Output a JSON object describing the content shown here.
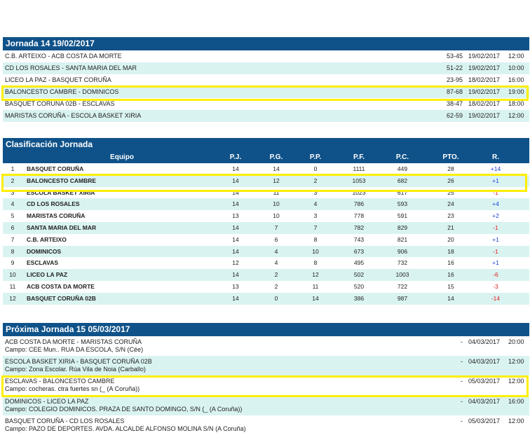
{
  "jornada": {
    "title": "Jornada 14 19/02/2017",
    "matches": [
      {
        "teams": "C.B. ARTEIXO - ACB COSTA DA MORTE",
        "score": "53-45",
        "date": "19/02/2017",
        "time": "12:00"
      },
      {
        "teams": "CD LOS ROSALES - SANTA MARIA DEL MAR",
        "score": "51-22",
        "date": "19/02/2017",
        "time": "10:00"
      },
      {
        "teams": "LICEO LA PAZ - BASQUET CORUÑA",
        "score": "23-95",
        "date": "18/02/2017",
        "time": "16:00"
      },
      {
        "teams": "BALONCESTO CAMBRE - DOMINICOS",
        "score": "87-68",
        "date": "19/02/2017",
        "time": "19:00"
      },
      {
        "teams": "BASQUET CORUÑA 02B - ESCLAVAS",
        "score": "38-47",
        "date": "18/02/2017",
        "time": "18:00"
      },
      {
        "teams": "MARISTAS CORUÑA - ESCOLA BASKET XIRIA",
        "score": "62-59",
        "date": "19/02/2017",
        "time": "12:00"
      }
    ]
  },
  "clasificacion": {
    "title": "Clasificación Jornada",
    "headers": {
      "equipo": "Equipo",
      "pj": "P.J.",
      "pg": "P.G.",
      "pp": "P.P.",
      "pf": "P.F.",
      "pc": "P.C.",
      "pto": "PTO.",
      "r": "R."
    },
    "rows": [
      {
        "pos": "1",
        "team": "BASQUET CORUÑA",
        "pj": "14",
        "pg": "14",
        "pp": "0",
        "pf": "1111",
        "pc": "449",
        "pto": "28",
        "r": "+14"
      },
      {
        "pos": "2",
        "team": "BALONCESTO CAMBRE",
        "pj": "14",
        "pg": "12",
        "pp": "2",
        "pf": "1053",
        "pc": "682",
        "pto": "26",
        "r": "+1"
      },
      {
        "pos": "3",
        "team": "ESCOLA BASKET XIRIA",
        "pj": "14",
        "pg": "11",
        "pp": "3",
        "pf": "1023",
        "pc": "617",
        "pto": "25",
        "r": "-1"
      },
      {
        "pos": "4",
        "team": "CD LOS ROSALES",
        "pj": "14",
        "pg": "10",
        "pp": "4",
        "pf": "786",
        "pc": "593",
        "pto": "24",
        "r": "+4"
      },
      {
        "pos": "5",
        "team": "MARISTAS CORUÑA",
        "pj": "13",
        "pg": "10",
        "pp": "3",
        "pf": "778",
        "pc": "591",
        "pto": "23",
        "r": "+2"
      },
      {
        "pos": "6",
        "team": "SANTA MARIA DEL MAR",
        "pj": "14",
        "pg": "7",
        "pp": "7",
        "pf": "782",
        "pc": "829",
        "pto": "21",
        "r": "-1"
      },
      {
        "pos": "7",
        "team": "C.B. ARTEIXO",
        "pj": "14",
        "pg": "6",
        "pp": "8",
        "pf": "743",
        "pc": "821",
        "pto": "20",
        "r": "+1"
      },
      {
        "pos": "8",
        "team": "DOMINICOS",
        "pj": "14",
        "pg": "4",
        "pp": "10",
        "pf": "673",
        "pc": "906",
        "pto": "18",
        "r": "-1"
      },
      {
        "pos": "9",
        "team": "ESCLAVAS",
        "pj": "12",
        "pg": "4",
        "pp": "8",
        "pf": "495",
        "pc": "732",
        "pto": "16",
        "r": "+1"
      },
      {
        "pos": "10",
        "team": "LICEO LA PAZ",
        "pj": "14",
        "pg": "2",
        "pp": "12",
        "pf": "502",
        "pc": "1003",
        "pto": "16",
        "r": "-6"
      },
      {
        "pos": "11",
        "team": "ACB COSTA DA MORTE",
        "pj": "13",
        "pg": "2",
        "pp": "11",
        "pf": "520",
        "pc": "722",
        "pto": "15",
        "r": "-3"
      },
      {
        "pos": "12",
        "team": "BASQUET CORUÑA 02B",
        "pj": "14",
        "pg": "0",
        "pp": "14",
        "pf": "386",
        "pc": "987",
        "pto": "14",
        "r": "-14"
      }
    ]
  },
  "proxima": {
    "title": "Próxima Jornada 15 05/03/2017",
    "matches": [
      {
        "teams": "ACB COSTA DA MORTE - MARISTAS CORUÑA",
        "campo": "Campo: CEE Mun.. RUA DA ESCOLA, S/N (Cée)",
        "dash": "-",
        "date": "04/03/2017",
        "time": "20:00"
      },
      {
        "teams": "ESCOLA BASKET XIRIA - BASQUET CORUÑA 02B",
        "campo": "Campo: Zona Escolar. Rúa Vila de Noia (Carballo)",
        "dash": "-",
        "date": "04/03/2017",
        "time": "12:00"
      },
      {
        "teams": "ESCLAVAS - BALONCESTO CAMBRE",
        "campo": "Campo: cocheras. ctra fuertes sn (_ (A Coruña))",
        "dash": "-",
        "date": "05/03/2017",
        "time": "12:00"
      },
      {
        "teams": "DOMINICOS - LICEO LA PAZ",
        "campo": "Campo: COLEGIO DOMINICOS. PRAZA DE SANTO DOMINGO, S/N (_ (A Coruña))",
        "dash": "-",
        "date": "04/03/2017",
        "time": "16:00"
      },
      {
        "teams": "BASQUET CORUÑA - CD LOS ROSALES",
        "campo": "Campo: PAZO DE DEPORTES. AVDA. ALCALDE ALFONSO MOLINA S/N (A Coruña)",
        "dash": "-",
        "date": "05/03/2017",
        "time": "12:00"
      }
    ]
  }
}
